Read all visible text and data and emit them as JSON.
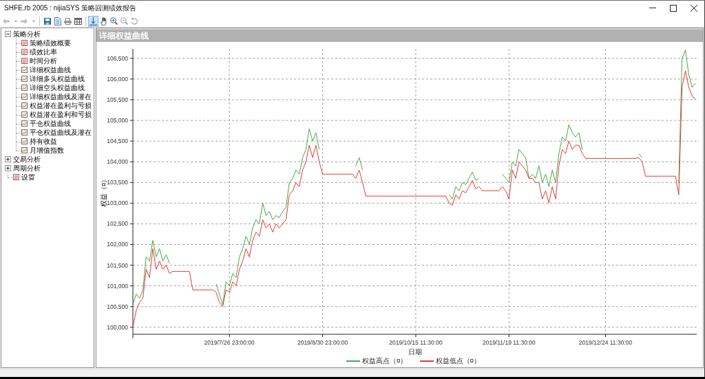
{
  "window": {
    "title": "SHFE.rb 2005 : nijiaSYS 策略回测绩效报告"
  },
  "toolbar": {
    "navigation": [
      {
        "disabled": true
      },
      {
        "disabled": true
      }
    ],
    "tools": [
      {
        "selected": true
      },
      {
        "selected": false
      },
      {
        "selected": false
      },
      {
        "selected": false
      },
      {
        "selected": false
      }
    ]
  },
  "sidebar": {
    "tree": [
      {
        "label": "策略分析",
        "expanded": true,
        "children": [
          {
            "label": "策略绩效概要",
            "kind": "report"
          },
          {
            "label": "绩效比率",
            "kind": "report"
          },
          {
            "label": "时间分析",
            "kind": "report"
          },
          {
            "label": "详细权益曲线",
            "kind": "chart"
          },
          {
            "label": "详细多头权益曲线",
            "kind": "chart"
          },
          {
            "label": "详细空头权益曲线",
            "kind": "chart"
          },
          {
            "label": "详细权益曲线及潜在",
            "kind": "chart"
          },
          {
            "label": "权益潜在盈利与亏损",
            "kind": "chart"
          },
          {
            "label": "权益潜在盈利和亏损",
            "kind": "chart"
          },
          {
            "label": "平仓权益曲线",
            "kind": "chart"
          },
          {
            "label": "平仓权益曲线及潜在",
            "kind": "chart"
          },
          {
            "label": "持有收益",
            "kind": "chart"
          },
          {
            "label": "月增值指数",
            "kind": "chart"
          }
        ]
      },
      {
        "label": "交易分析",
        "expanded": false
      },
      {
        "label": "周期分析",
        "expanded": false
      },
      {
        "label": "设置",
        "kind": "report"
      }
    ]
  },
  "panel": {
    "title": "详细权益曲线",
    "chart_data": {
      "type": "line",
      "xlabel": "日期",
      "ylabel": "权益（¤）",
      "grid": true,
      "legend": "bottom",
      "categories": [
        null,
        null,
        null,
        null,
        null,
        null,
        null,
        null,
        null,
        null,
        null,
        null,
        null,
        null,
        null,
        null,
        null,
        null,
        null,
        null,
        null,
        null,
        null,
        null,
        null,
        null,
        null,
        null,
        null,
        "2019/7/26 23:00:00",
        null,
        null,
        null,
        null,
        null,
        null,
        null,
        null,
        null,
        null,
        null,
        null,
        null,
        null,
        null,
        null,
        null,
        null,
        null,
        null,
        null,
        null,
        null,
        null,
        null,
        null,
        null,
        "2019/8/30 23:00:00",
        null,
        null,
        null,
        null,
        null,
        null,
        null,
        null,
        null,
        null,
        null,
        null,
        null,
        null,
        null,
        null,
        null,
        null,
        null,
        null,
        null,
        null,
        null,
        null,
        null,
        null,
        null,
        "2019/10/15 11:30:00",
        null,
        null,
        null,
        null,
        null,
        null,
        null,
        null,
        null,
        null,
        null,
        null,
        null,
        null,
        null,
        null,
        null,
        null,
        null,
        null,
        null,
        null,
        null,
        null,
        null,
        null,
        null,
        "2019/11/19 11:30:00",
        null,
        null,
        null,
        null,
        null,
        null,
        null,
        null,
        null,
        null,
        null,
        null,
        null,
        null,
        null,
        null,
        null,
        null,
        null,
        null,
        null,
        null,
        null,
        null,
        null,
        null,
        null,
        null,
        "2019/12/24 11:30:00",
        null,
        null,
        null,
        null,
        null,
        null,
        null,
        null,
        null,
        null,
        null,
        null,
        null,
        null,
        null,
        null,
        null,
        null,
        null,
        null,
        null,
        null,
        null,
        null,
        null,
        null,
        null
      ],
      "series": [
        {
          "name": "权益高点（¤）",
          "color": "#45a845",
          "values": [
            100550,
            100800,
            100700,
            100900,
            101700,
            101600,
            102100,
            101700,
            101900,
            101600,
            101750,
            101550,
            null,
            null,
            null,
            null,
            null,
            null,
            null,
            null,
            null,
            null,
            null,
            null,
            null,
            101050,
            100800,
            100550,
            101100,
            101000,
            101300,
            101200,
            101700,
            101900,
            102200,
            102000,
            102400,
            102600,
            102500,
            103000,
            102700,
            102800,
            102600,
            102700,
            102650,
            102800,
            102900,
            103500,
            103600,
            103800,
            103700,
            104100,
            104300,
            104800,
            104500,
            104700,
            104300,
            null,
            null,
            null,
            null,
            null,
            null,
            null,
            null,
            null,
            null,
            103900,
            104100,
            103800,
            null,
            null,
            null,
            null,
            null,
            null,
            null,
            null,
            null,
            null,
            null,
            null,
            null,
            null,
            null,
            null,
            null,
            null,
            null,
            null,
            null,
            null,
            null,
            null,
            null,
            103200,
            103100,
            103400,
            103300,
            103500,
            103450,
            103600,
            103750,
            103550,
            103600,
            null,
            null,
            null,
            null,
            null,
            null,
            103700,
            103600,
            103500,
            104000,
            103900,
            104300,
            104200,
            104100,
            103600,
            103700,
            103600,
            103900,
            103500,
            103700,
            103400,
            103800,
            103500,
            104200,
            104600,
            104500,
            104900,
            104700,
            104600,
            104700,
            104300,
            null,
            null,
            null,
            null,
            null,
            null,
            null,
            null,
            null,
            null,
            null,
            null,
            null,
            null,
            null,
            null,
            104200,
            104100,
            null,
            null,
            null,
            null,
            null,
            null,
            null,
            null,
            null,
            null,
            103500,
            106500,
            106700,
            106100,
            105800,
            105900
          ]
        },
        {
          "name": "权益低点（¤）",
          "color": "#e53935",
          "values": [
            100000,
            100400,
            100600,
            100700,
            101400,
            101200,
            101900,
            101400,
            101600,
            101400,
            101500,
            101300,
            101350,
            101350,
            101350,
            101350,
            101350,
            101350,
            100900,
            100900,
            100900,
            100900,
            100900,
            100900,
            100900,
            100850,
            100600,
            100500,
            100900,
            100850,
            101100,
            101000,
            101400,
            101600,
            101900,
            101700,
            102100,
            102300,
            102200,
            102600,
            102400,
            102500,
            102300,
            102500,
            102400,
            102500,
            102600,
            103200,
            103300,
            103500,
            103400,
            103800,
            104000,
            104400,
            104100,
            104400,
            104000,
            103700,
            103700,
            103700,
            103700,
            103700,
            103700,
            103700,
            103700,
            103700,
            103700,
            103600,
            103800,
            103500,
            103170,
            103170,
            103170,
            103170,
            103170,
            103170,
            103170,
            103170,
            103170,
            103170,
            103170,
            103170,
            103170,
            103170,
            103170,
            103170,
            103170,
            103170,
            103170,
            103170,
            103170,
            103170,
            103170,
            103170,
            103170,
            103000,
            102950,
            103200,
            103100,
            103300,
            103250,
            103400,
            103550,
            103350,
            103400,
            103300,
            103300,
            103300,
            103300,
            103300,
            103300,
            103400,
            103300,
            103100,
            103800,
            103600,
            104000,
            103900,
            103800,
            103600,
            103600,
            103500,
            103500,
            103100,
            103300,
            103000,
            103400,
            103100,
            103900,
            104300,
            104200,
            104500,
            104300,
            104400,
            104400,
            104200,
            104080,
            104080,
            104080,
            104080,
            104080,
            104080,
            104080,
            104080,
            104080,
            104080,
            104080,
            104080,
            104080,
            104080,
            104080,
            104080,
            104100,
            104000,
            103650,
            103650,
            103650,
            103650,
            103650,
            103650,
            103650,
            103650,
            103650,
            103650,
            103200,
            105800,
            106200,
            105800,
            105600,
            105500
          ]
        }
      ],
      "ylim": [
        99830,
        106730
      ],
      "yticks": [
        {
          "value": 100000,
          "label": "100,000"
        },
        {
          "value": 100500,
          "label": "100,500"
        },
        {
          "value": 101000,
          "label": "101,000"
        },
        {
          "value": 101500,
          "label": "101,500"
        },
        {
          "value": 102000,
          "label": "102,000"
        },
        {
          "value": 102500,
          "label": "102,500"
        },
        {
          "value": 103000,
          "label": "103,000"
        },
        {
          "value": 103500,
          "label": "103,500"
        },
        {
          "value": 104000,
          "label": "104,000"
        },
        {
          "value": 104500,
          "label": "104,500"
        },
        {
          "value": 105000,
          "label": "105,000"
        },
        {
          "value": 105500,
          "label": "105,500"
        },
        {
          "value": 106000,
          "label": "106,000"
        },
        {
          "value": 106500,
          "label": "106,500"
        }
      ]
    }
  }
}
